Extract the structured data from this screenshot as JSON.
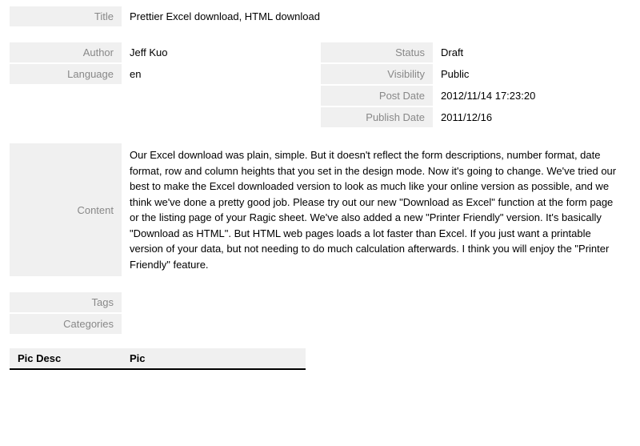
{
  "fields": {
    "title": {
      "label": "Title",
      "value": "Prettier Excel download, HTML download"
    },
    "author": {
      "label": "Author",
      "value": "Jeff Kuo"
    },
    "language": {
      "label": "Language",
      "value": "en"
    },
    "status": {
      "label": "Status",
      "value": "Draft"
    },
    "visibility": {
      "label": "Visibility",
      "value": "Public"
    },
    "postDate": {
      "label": "Post Date",
      "value": "2012/11/14 17:23:20"
    },
    "publishDate": {
      "label": "Publish Date",
      "value": "2011/12/16"
    },
    "content": {
      "label": "Content",
      "value": "Our Excel download was plain, simple. But it doesn't reflect the form descriptions, number format, date format, row and column heights that you set in the design mode. Now it's going to change. We've tried our best to make the Excel downloaded version to look as much like your online version as possible, and we think we've done a pretty good job. Please try out our new \"Download as Excel\" function at the form page or the listing page of your Ragic sheet. We've also added a new \"Printer Friendly\" version. It's basically \"Download as HTML\". But HTML web pages loads a lot faster than Excel. If you just want a printable version of your data, but not needing to do much calculation afterwards. I think you will enjoy the \"Printer Friendly\" feature."
    },
    "tags": {
      "label": "Tags",
      "value": ""
    },
    "categories": {
      "label": "Categories",
      "value": ""
    }
  },
  "table": {
    "headers": {
      "picDesc": "Pic Desc",
      "pic": "Pic"
    }
  }
}
